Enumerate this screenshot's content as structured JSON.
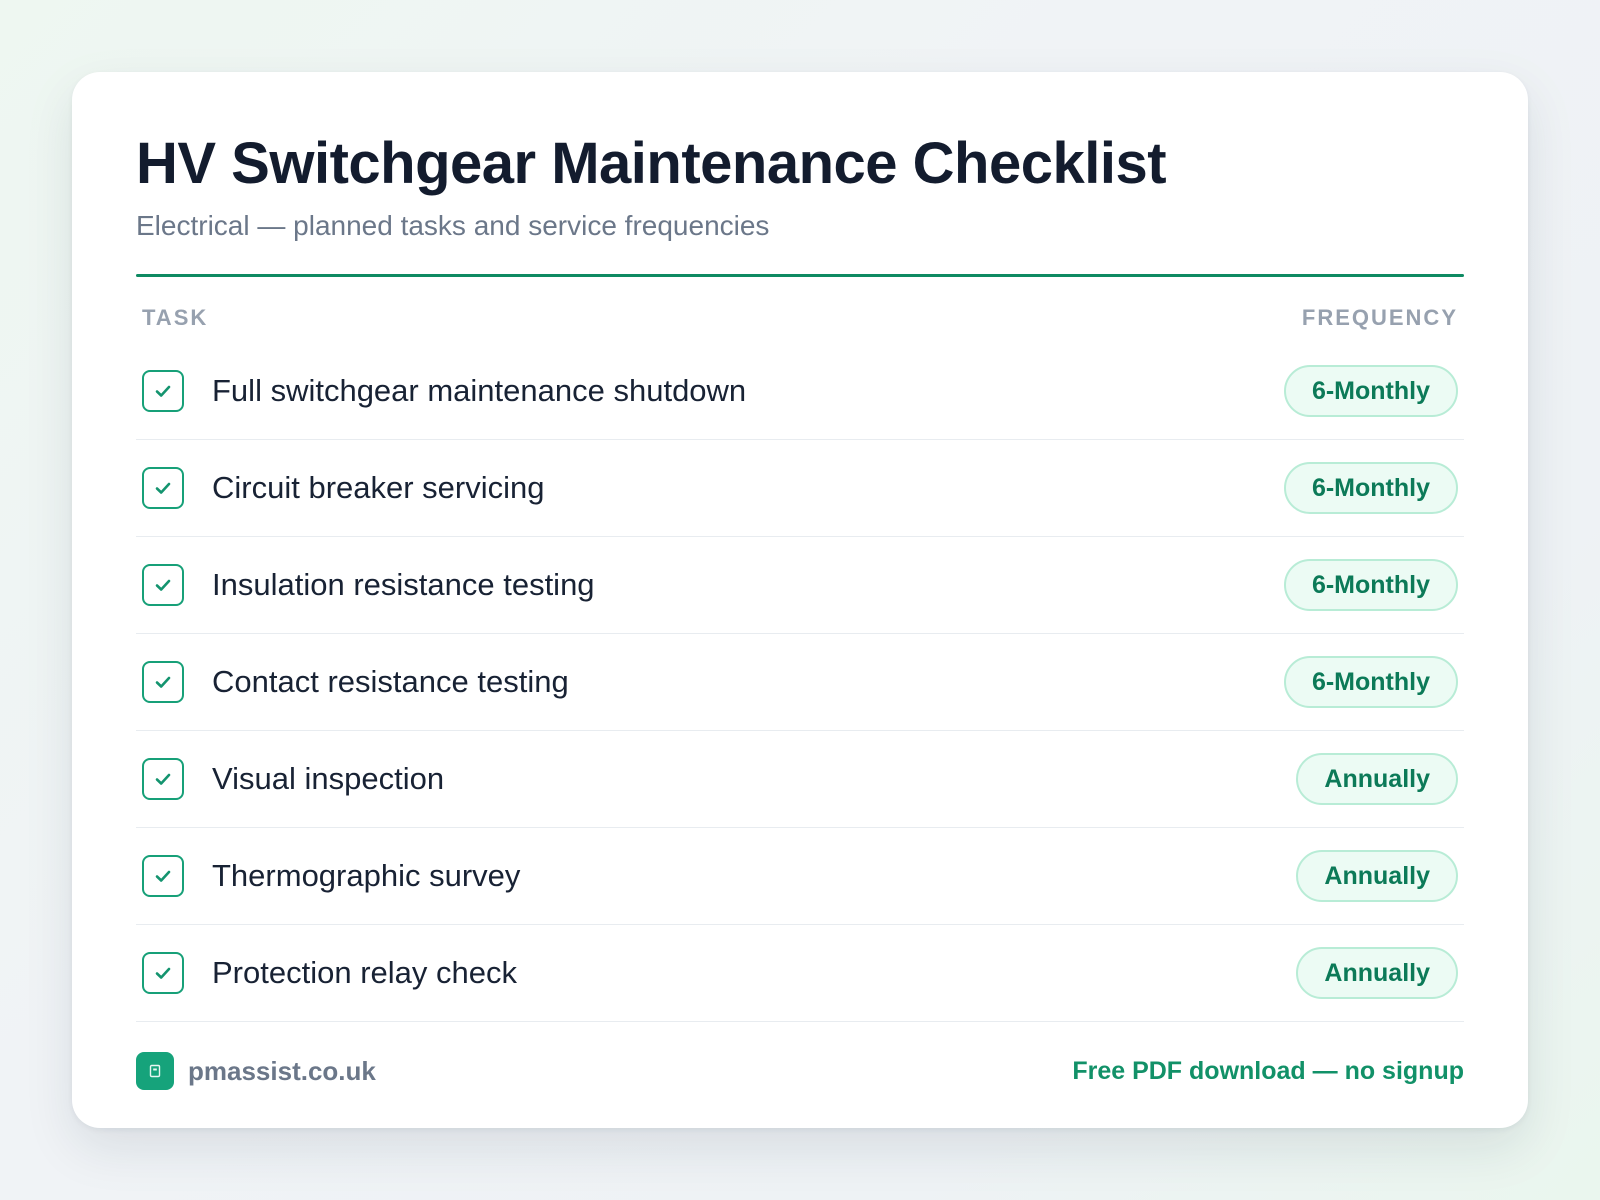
{
  "header": {
    "title": "HV Switchgear Maintenance Checklist",
    "subtitle": "Electrical — planned tasks and service frequencies"
  },
  "columns": {
    "task": "TASK",
    "frequency": "FREQUENCY"
  },
  "tasks": [
    {
      "label": "Full switchgear maintenance shutdown",
      "frequency": "6-Monthly",
      "checked": true
    },
    {
      "label": "Circuit breaker servicing",
      "frequency": "6-Monthly",
      "checked": true
    },
    {
      "label": "Insulation resistance testing",
      "frequency": "6-Monthly",
      "checked": true
    },
    {
      "label": "Contact resistance testing",
      "frequency": "6-Monthly",
      "checked": true
    },
    {
      "label": "Visual inspection",
      "frequency": "Annually",
      "checked": true
    },
    {
      "label": "Thermographic survey",
      "frequency": "Annually",
      "checked": true
    },
    {
      "label": "Protection relay check",
      "frequency": "Annually",
      "checked": true
    }
  ],
  "footer": {
    "brand": "pmassist.co.uk",
    "cta": "Free PDF download — no signup"
  },
  "icons": {
    "checkbox": "check-icon",
    "brand_logo": "building-icon"
  },
  "colors": {
    "accent": "#0e8a62",
    "badge_text": "#0c7a58",
    "badge_bg": "#ecfbf4",
    "badge_border": "#b8ecd6",
    "title": "#131c2e",
    "muted": "#6b7789"
  }
}
